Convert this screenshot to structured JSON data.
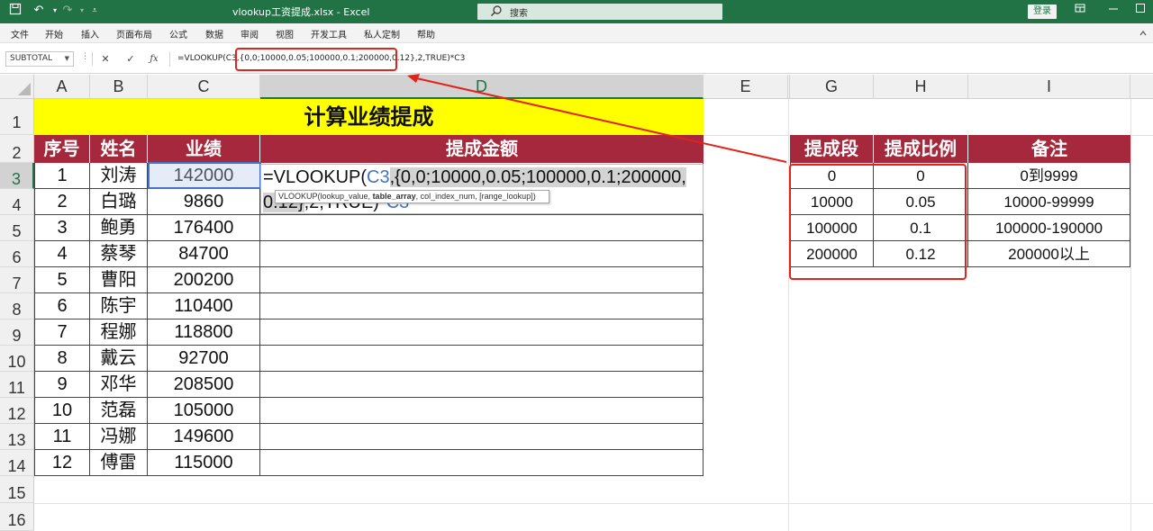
{
  "titlebar": {
    "title": "vlookup工资提成.xlsx  -  Excel",
    "search_label": "搜索",
    "login_label": "登录"
  },
  "menu": [
    "文件",
    "开始",
    "插入",
    "页面布局",
    "公式",
    "数据",
    "审阅",
    "视图",
    "开发工具",
    "私人定制",
    "帮助"
  ],
  "formula_bar": {
    "name_box": "SUBTOTAL",
    "formula": "=VLOOKUP(C3,{0,0;10000,0.05;100000,0.1;200000,0.12},2,TRUE)*C3"
  },
  "columns": [
    "A",
    "B",
    "C",
    "D",
    "E",
    "F",
    "G",
    "H",
    "I"
  ],
  "rows": [
    "1",
    "2",
    "3",
    "4",
    "5",
    "6",
    "7",
    "8",
    "9",
    "10",
    "11",
    "12",
    "13",
    "14",
    "15",
    "16"
  ],
  "sheet": {
    "title": "计算业绩提成",
    "headers": [
      "序号",
      "姓名",
      "业绩",
      "提成金额"
    ],
    "records": [
      [
        "1",
        "刘涛",
        "142000"
      ],
      [
        "2",
        "白璐",
        "9860"
      ],
      [
        "3",
        "鲍勇",
        "176400"
      ],
      [
        "4",
        "蔡琴",
        "84700"
      ],
      [
        "5",
        "曹阳",
        "200200"
      ],
      [
        "6",
        "陈宇",
        "110400"
      ],
      [
        "7",
        "程娜",
        "118800"
      ],
      [
        "8",
        "戴云",
        "92700"
      ],
      [
        "9",
        "邓华",
        "208500"
      ],
      [
        "10",
        "范磊",
        "105000"
      ],
      [
        "11",
        "冯娜",
        "149600"
      ],
      [
        "12",
        "傅雷",
        "115000"
      ]
    ]
  },
  "editing": {
    "line1_prefix": "=VLOOKUP(",
    "line1_ref": "C3",
    "line1_sel": ",{0,0;10000,0.05;100000,0.1;200000,",
    "line2_sel": "0.12}",
    "line2_rest": ",2,TRUE)*",
    "line2_ref": "C3",
    "tooltip_a": "VLOOKUP(lookup_value, ",
    "tooltip_b": "table_array",
    "tooltip_c": ", col_index_num, [range_lookup])"
  },
  "rate_table": {
    "headers": [
      "提成段",
      "提成比例",
      "备注"
    ],
    "rows": [
      [
        "0",
        "0",
        "0到9999"
      ],
      [
        "10000",
        "0.05",
        "10000-99999"
      ],
      [
        "100000",
        "0.1",
        "100000-190000"
      ],
      [
        "200000",
        "0.12",
        "200000以上"
      ]
    ]
  },
  "colors": {
    "excel_green": "#217346",
    "header_red": "#a6283c",
    "title_yellow": "#ffff00",
    "annotation_red": "#e2231a",
    "ref_blue": "#4472c4"
  }
}
